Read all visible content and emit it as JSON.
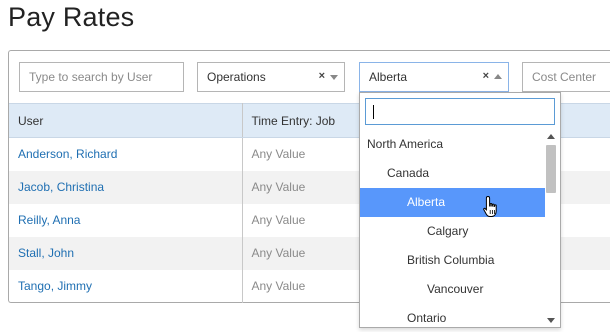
{
  "page": {
    "title": "Pay Rates"
  },
  "filters": {
    "user_search": {
      "placeholder": "Type to search by User",
      "value": ""
    },
    "operations": {
      "value": "Operations",
      "clear": "×"
    },
    "region": {
      "value": "Alberta",
      "clear": "×"
    },
    "cost_center": {
      "placeholder": "Cost Center"
    }
  },
  "table": {
    "columns": [
      "User",
      "Time Entry: Job"
    ],
    "rows": [
      {
        "user": "Anderson, Richard",
        "job": "Any Value"
      },
      {
        "user": "Jacob, Christina",
        "job": "Any Value"
      },
      {
        "user": "Reilly, Anna",
        "job": "Any Value"
      },
      {
        "user": "Stall, John",
        "job": "Any Value"
      },
      {
        "user": "Tango, Jimmy",
        "job": "Any Value"
      }
    ]
  },
  "dropdown": {
    "search_value": "",
    "items": [
      {
        "label": "North America",
        "level": 0,
        "selected": false
      },
      {
        "label": "Canada",
        "level": 1,
        "selected": false
      },
      {
        "label": "Alberta",
        "level": 2,
        "selected": true
      },
      {
        "label": "Calgary",
        "level": 3,
        "selected": false
      },
      {
        "label": "British Columbia",
        "level": 2,
        "selected": false
      },
      {
        "label": "Vancouver",
        "level": 3,
        "selected": false
      },
      {
        "label": "Ontario",
        "level": 2,
        "selected": false
      }
    ]
  },
  "colors": {
    "link": "#1f6fb2",
    "header_bg": "#deeaf6",
    "selected_bg": "#5897fb",
    "row_alt_bg": "#f2f2f2"
  },
  "icons": {
    "clear": "close-icon",
    "dropdown_arrow": "chevron-down-icon",
    "dropdown_arrow_open": "chevron-up-icon",
    "cursor": "hand-pointer-icon"
  }
}
